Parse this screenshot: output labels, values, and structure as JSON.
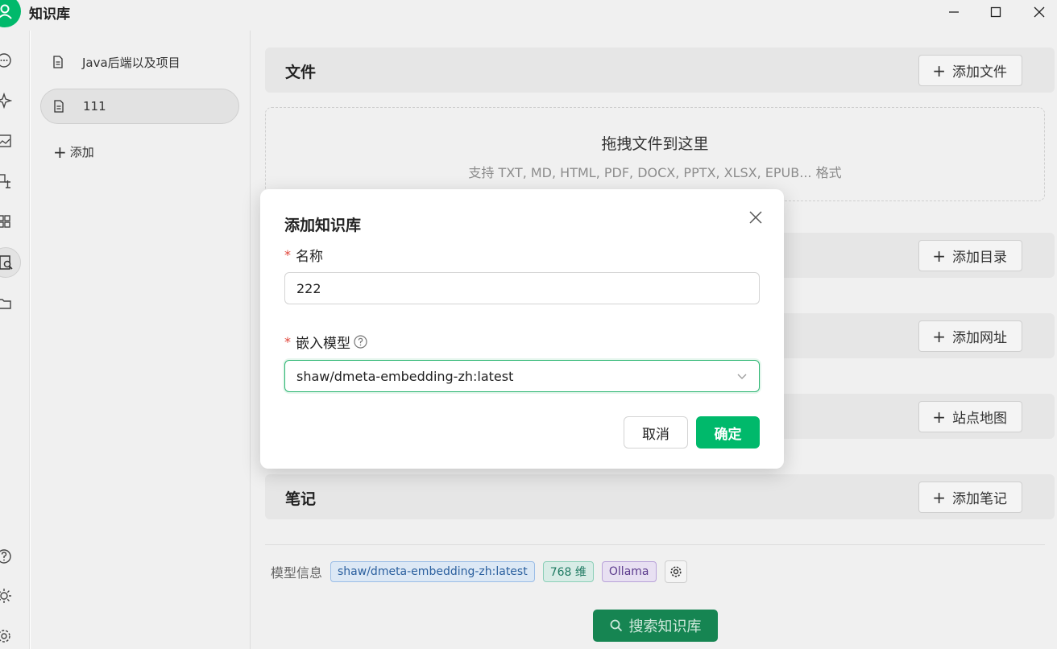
{
  "app": {
    "title": "知识库"
  },
  "window_controls": {
    "minimize_icon": "minimize-icon",
    "maximize_icon": "maximize-icon",
    "close_icon": "close-icon"
  },
  "rail": {
    "icons": [
      "chat-icon",
      "sparkle-icon",
      "image-icon",
      "translate-icon",
      "apps-icon",
      "knowledge-icon",
      "folder-icon",
      "help-icon",
      "theme-icon",
      "settings-icon"
    ],
    "active": "knowledge-icon"
  },
  "kb_list": {
    "items": [
      {
        "label": "Java后端以及项目",
        "selected": false
      },
      {
        "label": "111",
        "selected": true
      }
    ],
    "add_label": "添加"
  },
  "main": {
    "sections": [
      {
        "title": "文件",
        "button": "添加文件"
      },
      {
        "title": "",
        "button": "添加目录"
      },
      {
        "title": "",
        "button": "添加网址"
      },
      {
        "title": "",
        "button": "站点地图"
      },
      {
        "title": "笔记",
        "button": "添加笔记"
      }
    ],
    "dropzone": {
      "title": "拖拽文件到这里",
      "subtitle": "支持 TXT, MD, HTML, PDF, DOCX, PPTX, XLSX, EPUB... 格式"
    },
    "model_info": {
      "label": "模型信息",
      "model_tag": "shaw/dmeta-embedding-zh:latest",
      "dim_tag": "768 维",
      "provider_tag": "Ollama"
    },
    "search_button": "搜索知识库"
  },
  "modal": {
    "title": "添加知识库",
    "name_label": "名称",
    "name_value": "222",
    "embed_label": "嵌入模型",
    "embed_value": "shaw/dmeta-embedding-zh:latest",
    "cancel": "取消",
    "ok": "确定"
  },
  "colors": {
    "accent": "#00b96b",
    "accent_dark": "#168552",
    "required": "#e0453a"
  }
}
